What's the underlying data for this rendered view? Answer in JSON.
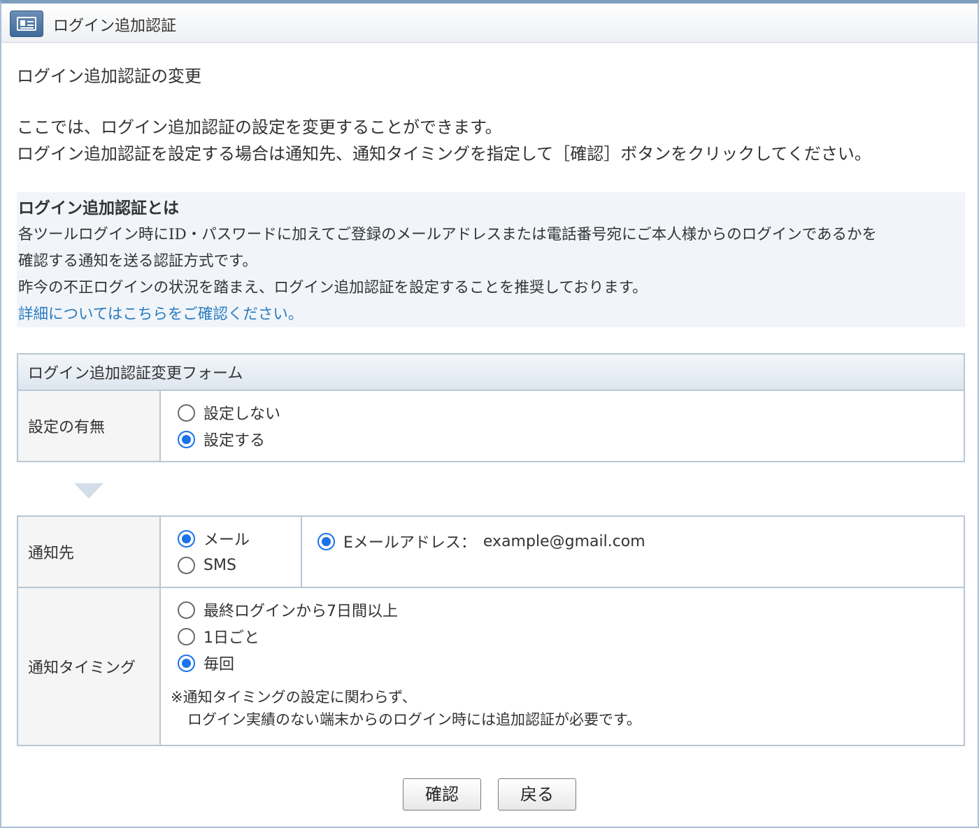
{
  "window": {
    "title": "ログイン追加認証",
    "icon": "id-card-icon"
  },
  "page": {
    "heading": "ログイン追加認証の変更",
    "intro": [
      "ここでは、ログイン追加認証の設定を変更することができます。",
      "ログイン追加認証を設定する場合は通知先、通知タイミングを指定して［確認］ボタンをクリックしてください。"
    ]
  },
  "info": {
    "title": "ログイン追加認証とは",
    "lines": [
      "各ツールログイン時にID・パスワードに加えてご登録のメールアドレスまたは電話番号宛にご本人様からのログインであるかを",
      "確認する通知を送る認証方式です。",
      "昨今の不正ログインの状況を踏まえ、ログイン追加認証を設定することを推奨しております。"
    ],
    "link": "詳細についてはこちらをご確認ください。"
  },
  "form": {
    "header": "ログイン追加認証変更フォーム",
    "setting": {
      "label": "設定の有無",
      "options": [
        {
          "label": "設定しない",
          "selected": false
        },
        {
          "label": "設定する",
          "selected": true
        }
      ]
    },
    "destination": {
      "label": "通知先",
      "options": [
        {
          "label": "メール",
          "selected": true
        },
        {
          "label": "SMS",
          "selected": false
        }
      ],
      "email": {
        "label": "Eメールアドレス：",
        "value": "example@gmail.com",
        "selected": true
      }
    },
    "timing": {
      "label": "通知タイミング",
      "options": [
        {
          "label": "最終ログインから7日間以上",
          "selected": false
        },
        {
          "label": "1日ごと",
          "selected": false
        },
        {
          "label": "毎回",
          "selected": true
        }
      ],
      "note": [
        "※通知タイミングの設定に関わらず、",
        "ログイン実績のない端末からのログイン時には追加認証が必要です。"
      ]
    }
  },
  "buttons": {
    "confirm": "確認",
    "back": "戻る"
  },
  "colors": {
    "accent": "#1a73e8",
    "link": "#2a7bc0",
    "border": "#b8c7d6",
    "infobox": "#f1f5f9"
  }
}
